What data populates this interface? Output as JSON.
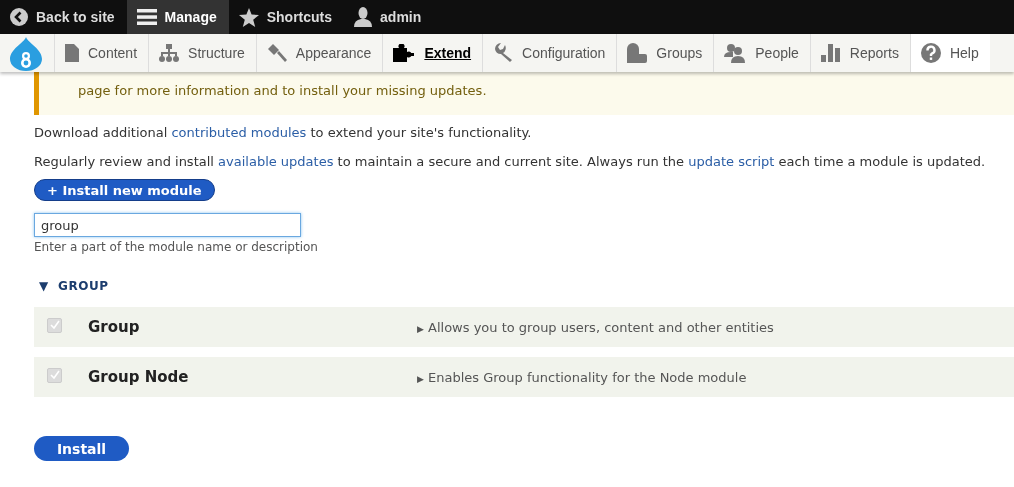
{
  "toolbar": {
    "items": [
      {
        "label": "Back to site",
        "selected": false
      },
      {
        "label": "Manage",
        "selected": true
      },
      {
        "label": "Shortcuts",
        "selected": false
      },
      {
        "label": "admin",
        "selected": false
      }
    ]
  },
  "tray": {
    "items": [
      {
        "label": "Content",
        "selected": false
      },
      {
        "label": "Structure",
        "selected": false
      },
      {
        "label": "Appearance",
        "selected": false
      },
      {
        "label": "Extend",
        "selected": true
      },
      {
        "label": "Configuration",
        "selected": false
      },
      {
        "label": "Groups",
        "selected": false
      },
      {
        "label": "People",
        "selected": false
      },
      {
        "label": "Reports",
        "selected": false
      },
      {
        "label": "Help",
        "selected": false
      }
    ]
  },
  "message": {
    "text": "page for more information and to install your missing updates."
  },
  "paragraphs": [
    [
      {
        "text": "Download additional ",
        "link": false
      },
      {
        "text": "contributed modules",
        "link": true
      },
      {
        "text": " to extend your site's functionality.",
        "link": false
      }
    ],
    [
      {
        "text": "Regularly review and install ",
        "link": false
      },
      {
        "text": "available updates",
        "link": true
      },
      {
        "text": " to maintain a secure and current site. Always run the ",
        "link": false
      },
      {
        "text": "update script",
        "link": true
      },
      {
        "text": " each time a module is updated.",
        "link": false
      }
    ]
  ],
  "install_new_button": {
    "label": "+ Install new module"
  },
  "filter": {
    "value": "group",
    "description": "Enter a part of the module name or description"
  },
  "section": {
    "marker": "▼",
    "title": "GROUP",
    "modules": [
      {
        "name": "Group",
        "checked": true,
        "disabled": true,
        "marker": "▶",
        "description": "Allows you to group users, content and other entities"
      },
      {
        "name": "Group Node",
        "checked": true,
        "disabled": true,
        "marker": "▶",
        "description": "Enables Group functionality for the Node module"
      }
    ]
  },
  "install_button": {
    "label": "Install"
  }
}
